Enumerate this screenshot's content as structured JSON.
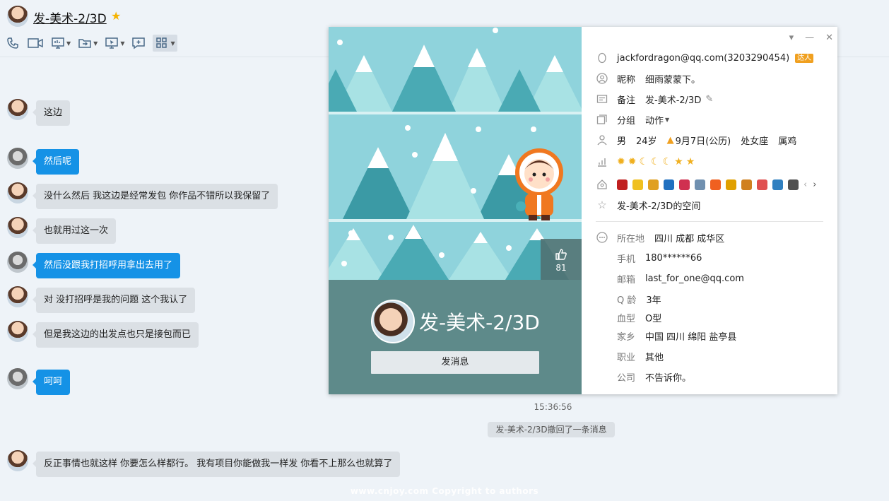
{
  "header": {
    "title": "发-美术-2/3D"
  },
  "toolbar": {
    "items": [
      "phone-icon",
      "video-icon",
      "screen-share-icon",
      "file-transfer-icon",
      "remote-desktop-icon",
      "add-chat-icon",
      "apps-icon"
    ]
  },
  "messages": [
    {
      "side": "in",
      "text": "这边"
    },
    {
      "side": "out",
      "text": "然后呢"
    },
    {
      "side": "in",
      "text": "没什么然后 我这边是经常发包 你作品不错所以我保留了"
    },
    {
      "side": "in",
      "text": "也就用过这一次"
    },
    {
      "side": "out",
      "text": "然后没跟我打招呼用拿出去用了"
    },
    {
      "side": "in",
      "text": "对 没打招呼是我的问题  这个我认了"
    },
    {
      "side": "in",
      "text": "但是我这边的出发点也只是接包而已"
    },
    {
      "side": "out",
      "text": "呵呵"
    },
    {
      "side": "in",
      "text": "反正事情也就这样 你要怎么样都行。 我有项目你能做我一样发 你看不上那么也就算了"
    }
  ],
  "timestamp": "15:36:56",
  "recall_notice": "发-美术-2/3D撤回了一条消息",
  "watermark": "www.cnjoy.com  Copyright  to  authors",
  "profile": {
    "likes": "81",
    "display_name": "发-美术-2/3D",
    "send_button": "发消息",
    "account": "jackfordragon@qq.com(3203290454)",
    "vip_tag": "达人",
    "nickname_label": "昵称",
    "nickname": "细雨蒙蒙下。",
    "remark_label": "备注",
    "remark": "发-美术-2/3D",
    "group_label": "分组",
    "group": "动作",
    "gender": "男",
    "age": "24岁",
    "birthday": "9月7日(公历)",
    "zodiac": "处女座",
    "chinese_zodiac": "属鸡",
    "space": "发-美术-2/3D的空间",
    "location_label": "所在地",
    "location": "四川 成都 成华区",
    "phone_label": "手机",
    "phone": "180******66",
    "email_label": "邮箱",
    "email": "last_for_one@qq.com",
    "qage_label": "Q 龄",
    "qage": "3年",
    "blood_label": "血型",
    "blood": "O型",
    "hometown_label": "家乡",
    "hometown": "中国 四川 绵阳 盐亭县",
    "job_label": "职业",
    "job": "其他",
    "company_label": "公司",
    "company": "不告诉你。"
  }
}
